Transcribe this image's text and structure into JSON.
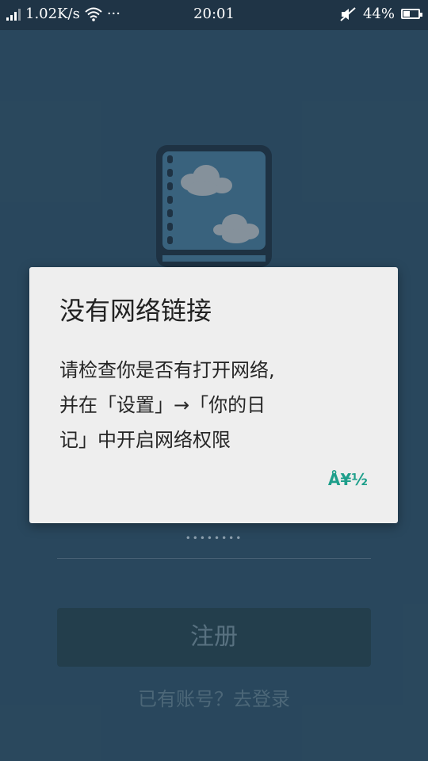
{
  "status_bar": {
    "speed": "1.02K/s",
    "more": "···",
    "time": "20:01",
    "battery": "44%",
    "battery_level": 0.44
  },
  "register_button": {
    "label": "注册"
  },
  "login_link": {
    "label": "已有账号？去登录"
  },
  "password_mask": "••••••••",
  "dialog": {
    "title": "没有网络链接",
    "message": "请检查你是否有打开网络,\n并在「设置」→「你的日\n记」中开启网络权限",
    "ok_label": "Å¥½"
  }
}
